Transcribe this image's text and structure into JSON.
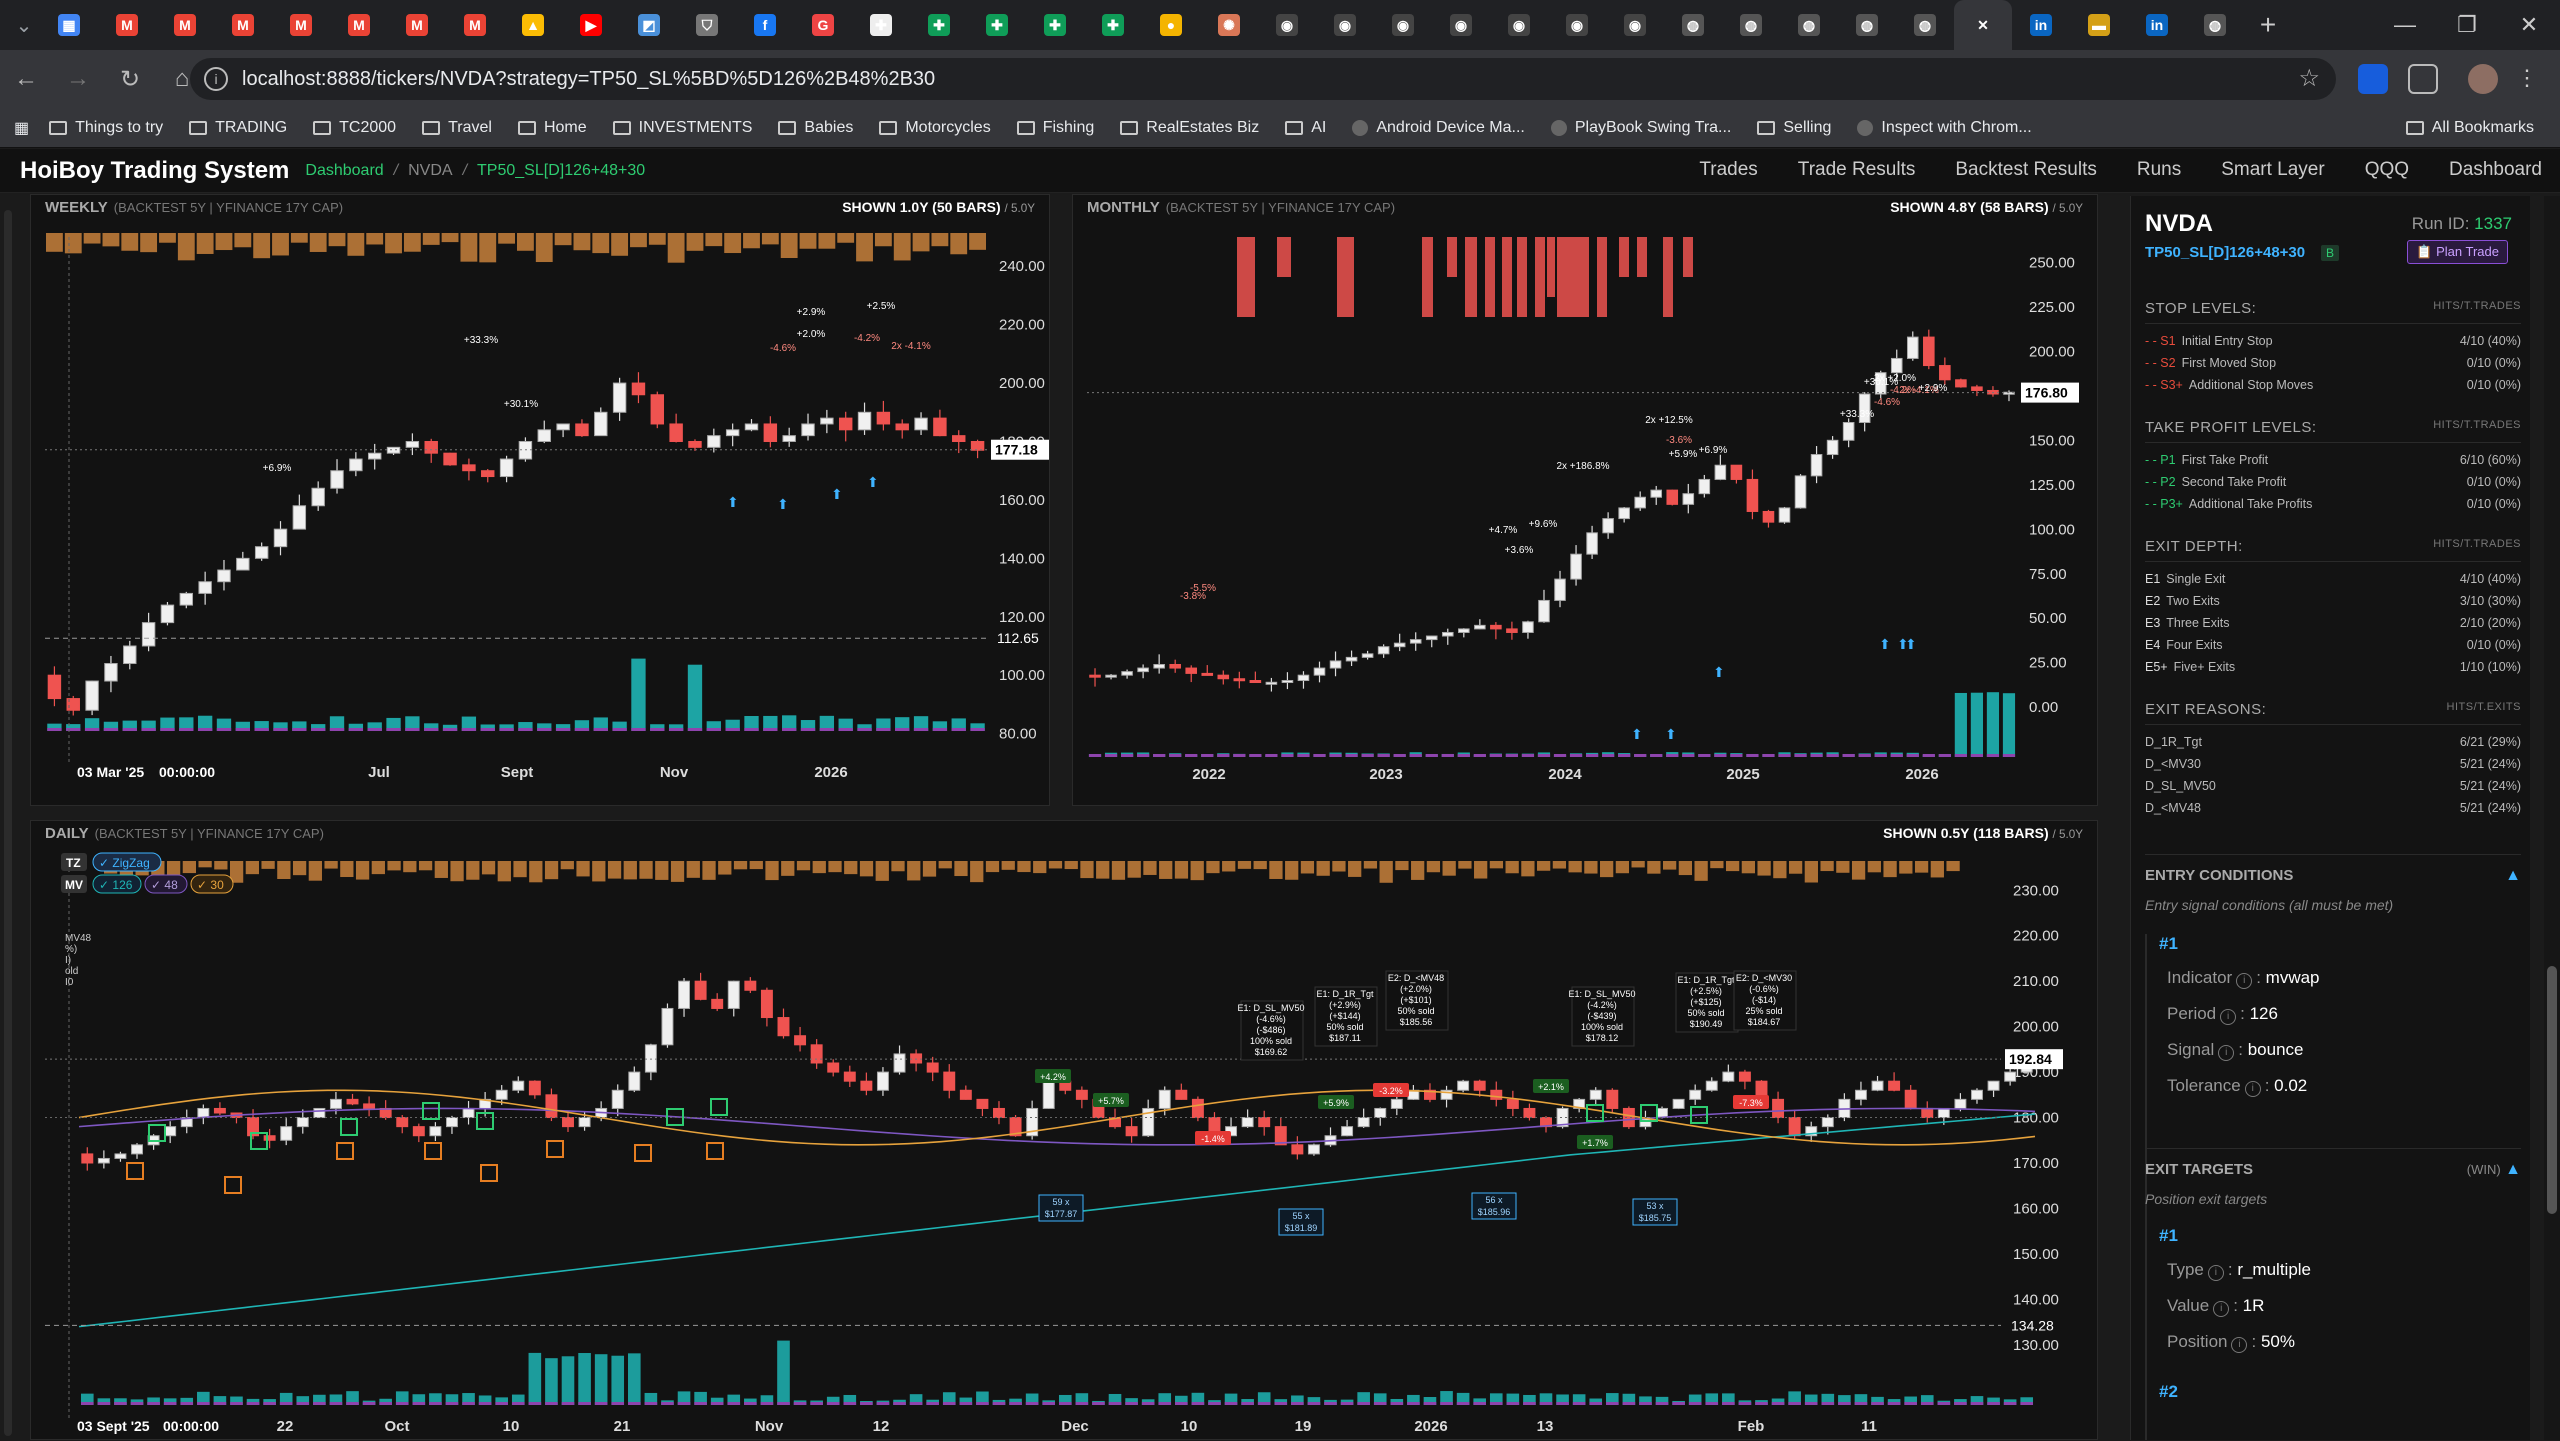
{
  "browser": {
    "url": "localhost:8888/tickers/NVDA?strategy=TP50_SL%5BD%5D126%2B48%2B30",
    "tabs": [
      {
        "icon": "grid-icon",
        "color": "#4285f4",
        "label": "▦"
      },
      {
        "icon": "gmail-icon",
        "color": "#ea4335",
        "label": "M"
      },
      {
        "icon": "gmail-icon",
        "color": "#ea4335",
        "label": "M"
      },
      {
        "icon": "gmail-icon",
        "color": "#ea4335",
        "label": "M"
      },
      {
        "icon": "gmail-icon",
        "color": "#ea4335",
        "label": "M"
      },
      {
        "icon": "gmail-icon",
        "color": "#ea4335",
        "label": "M"
      },
      {
        "icon": "gmail-icon",
        "color": "#ea4335",
        "label": "M"
      },
      {
        "icon": "gmail-icon",
        "color": "#ea4335",
        "label": "M"
      },
      {
        "icon": "drive-icon",
        "color": "#fbbc04",
        "label": "▲"
      },
      {
        "icon": "youtube-icon",
        "color": "#ff0000",
        "label": "▶"
      },
      {
        "icon": "app-icon",
        "color": "#4a90d9",
        "label": "◩"
      },
      {
        "icon": "shield-icon",
        "color": "#777",
        "label": "⛉"
      },
      {
        "icon": "facebook-icon",
        "color": "#1877f2",
        "label": "f"
      },
      {
        "icon": "app-icon",
        "color": "#e44",
        "label": "G"
      },
      {
        "icon": "app-icon",
        "color": "#eee",
        "label": "✚"
      },
      {
        "icon": "sheets-icon",
        "color": "#0f9d58",
        "label": "✚"
      },
      {
        "icon": "sheets-icon",
        "color": "#0f9d58",
        "label": "✚"
      },
      {
        "icon": "sheets-icon",
        "color": "#0f9d58",
        "label": "✚"
      },
      {
        "icon": "sheets-icon",
        "color": "#0f9d58",
        "label": "✚"
      },
      {
        "icon": "coin-icon",
        "color": "#f4b400",
        "label": "●"
      },
      {
        "icon": "claude-icon",
        "color": "#d97757",
        "label": "✺"
      },
      {
        "icon": "github-icon",
        "color": "#444",
        "label": "◉"
      },
      {
        "icon": "github-icon",
        "color": "#444",
        "label": "◉"
      },
      {
        "icon": "github-icon",
        "color": "#444",
        "label": "◉"
      },
      {
        "icon": "github-icon",
        "color": "#444",
        "label": "◉"
      },
      {
        "icon": "github-icon",
        "color": "#444",
        "label": "◉"
      },
      {
        "icon": "github-icon",
        "color": "#444",
        "label": "◉"
      },
      {
        "icon": "github-icon",
        "color": "#444",
        "label": "◉"
      },
      {
        "icon": "globe-icon",
        "color": "#555",
        "label": "◍"
      },
      {
        "icon": "globe-icon",
        "color": "#555",
        "label": "◍"
      },
      {
        "icon": "globe-icon",
        "color": "#555",
        "label": "◍"
      },
      {
        "icon": "globe-icon",
        "color": "#555",
        "label": "◍"
      },
      {
        "icon": "globe-icon",
        "color": "#555",
        "label": "◍"
      },
      {
        "icon": "close-icon",
        "color": "#35363a",
        "label": "✕"
      },
      {
        "icon": "linkedin-icon",
        "color": "#0a66c2",
        "label": "in"
      },
      {
        "icon": "flag-icon",
        "color": "#d4a017",
        "label": "▬"
      },
      {
        "icon": "linkedin-icon",
        "color": "#0a66c2",
        "label": "in"
      },
      {
        "icon": "globe-icon",
        "color": "#555",
        "label": "◍"
      }
    ],
    "bookmarks": [
      {
        "icon": "folder-icon",
        "label": "Things to try"
      },
      {
        "icon": "folder-icon",
        "label": "TRADING"
      },
      {
        "icon": "folder-icon",
        "label": "TC2000"
      },
      {
        "icon": "folder-icon",
        "label": "Travel"
      },
      {
        "icon": "folder-icon",
        "label": "Home"
      },
      {
        "icon": "folder-icon",
        "label": "INVESTMENTS"
      },
      {
        "icon": "folder-icon",
        "label": "Babies"
      },
      {
        "icon": "folder-icon",
        "label": "Motorcycles"
      },
      {
        "icon": "folder-icon",
        "label": "Fishing"
      },
      {
        "icon": "folder-icon",
        "label": "RealEstates Biz"
      },
      {
        "icon": "folder-icon",
        "label": "AI"
      },
      {
        "icon": "android-icon",
        "label": "Android Device Ma..."
      },
      {
        "icon": "playbook-icon",
        "label": "PlayBook Swing Tra..."
      },
      {
        "icon": "folder-icon",
        "label": "Selling"
      },
      {
        "icon": "globe-icon",
        "label": "Inspect with Chrom..."
      }
    ],
    "all_bookmarks": "All Bookmarks"
  },
  "app": {
    "title": "HoiBoy Trading System",
    "breadcrumb": [
      "Dashboard",
      "NVDA",
      "TP50_SL[D]126+48+30"
    ],
    "nav": [
      "Trades",
      "Trade Results",
      "Backtest Results",
      "Runs",
      "Smart Layer",
      "QQQ",
      "Dashboard"
    ]
  },
  "weekly": {
    "title": "WEEKLY",
    "sub": "(BACKTEST 5Y | YFINANCE 17Y CAP)",
    "shown": "SHOWN 1.0Y (50 BARS)",
    "scale": "/ 5.0Y",
    "yticks": [
      "240.00",
      "220.00",
      "200.00",
      "180.00",
      "160.00",
      "140.00",
      "120.00",
      "100.00",
      "80.00"
    ],
    "last_price": "177.18",
    "ref_price": "112.65",
    "xticks": [
      "Jul",
      "Sept",
      "Nov",
      "2026"
    ],
    "cursor_date": "03 Mar '25",
    "cursor_time": "00:00:00",
    "annotations": [
      "+6.9%",
      "+33.3%",
      "+30.1%",
      "+2.9%",
      "+2.0%",
      "-4.6%",
      "+2.5%",
      "-4.2%",
      "2x -4.1%"
    ]
  },
  "monthly": {
    "title": "MONTHLY",
    "sub": "(BACKTEST 5Y | YFINANCE 17Y CAP)",
    "shown": "SHOWN 4.8Y (58 BARS)",
    "scale": "/ 5.0Y",
    "yticks": [
      "250.00",
      "225.00",
      "200.00",
      "175.00",
      "150.00",
      "125.00",
      "100.00",
      "75.00",
      "50.00",
      "25.00",
      "0.00"
    ],
    "last_price": "176.80",
    "xticks": [
      "2022",
      "2023",
      "2024",
      "2025",
      "2026"
    ],
    "annotations": [
      "-5.5%",
      "-3.8%",
      "+4.7%",
      "+9.6%",
      "+3.6%",
      "2x +186.8%",
      "2x +12.5%",
      "-3.6%",
      "+5.9%",
      "+6.9%",
      "+30.1%",
      "+33.3%",
      "2x +2.0%",
      "-4.6%",
      "-4.2%",
      "2x -4.1%",
      "+2.9%"
    ]
  },
  "daily": {
    "title": "DAILY",
    "sub": "(BACKTEST 5Y | YFINANCE 17Y CAP)",
    "shown": "SHOWN 0.5Y (118 BARS)",
    "scale": "/ 5.0Y",
    "yticks": [
      "230.00",
      "220.00",
      "210.00",
      "200.00",
      "190.00",
      "180.00",
      "170.00",
      "160.00",
      "150.00",
      "140.00",
      "130.00"
    ],
    "last_price": "192.84",
    "ref_price": "134.28",
    "xticks": [
      "22",
      "Oct",
      "10",
      "21",
      "Nov",
      "12",
      "Dec",
      "10",
      "19",
      "2026",
      "13",
      "Feb",
      "11"
    ],
    "cursor_date": "03 Sept '25",
    "cursor_time": "00:00:00",
    "legend": {
      "tz": "TZ",
      "zigzag": "✓ ZigZag",
      "mv": "MV",
      "mv126": "✓ 126",
      "mv48": "✓ 48",
      "mv30": "✓ 30"
    },
    "side_labels": [
      "MV48",
      "%)",
      "I)",
      "old",
      "I0"
    ],
    "exits": [
      {
        "lines": [
          "E1: D_SL_MV50",
          "(-4.6%)",
          "(-$486)",
          "100% sold",
          "$169.62"
        ]
      },
      {
        "lines": [
          "E1: D_1R_Tgt",
          "(+2.9%)",
          "(+$144)",
          "50% sold",
          "$187.11"
        ]
      },
      {
        "lines": [
          "E2: D_<MV48",
          "(+2.0%)",
          "(+$101)",
          "50% sold",
          "$185.56"
        ]
      },
      {
        "lines": [
          "E1: D_SL_MV50",
          "(-4.2%)",
          "(-$439)",
          "100% sold",
          "$178.12"
        ]
      },
      {
        "lines": [
          "E1: D_1R_Tgt",
          "(+2.5%)",
          "(+$125)",
          "50% sold",
          "$190.49"
        ]
      },
      {
        "lines": [
          "E2: D_<MV30",
          "(-0.6%)",
          "(-$14)",
          "25% sold",
          "$184.67"
        ]
      }
    ],
    "entries": [
      {
        "lines": [
          "59 x",
          "$177.87"
        ]
      },
      {
        "lines": [
          "55 x",
          "$181.89"
        ]
      },
      {
        "lines": [
          "56 x",
          "$185.96"
        ]
      },
      {
        "lines": [
          "53 x",
          "$185.75"
        ]
      }
    ],
    "pills": [
      "+5.7%",
      "+5.9%",
      "-3.2%",
      "-1.4%",
      "+1.7%",
      "-7.3%",
      "+4.2%",
      "+2.1%"
    ]
  },
  "side": {
    "symbol": "NVDA",
    "run_label": "Run ID:",
    "run_id": "1337",
    "strategy": "TP50_SL[D]126+48+30",
    "badge": "B",
    "plan_button": "📋 Plan Trade",
    "stop_levels": {
      "title": "STOP LEVELS:",
      "hdr": "HITS/T.TRADES",
      "rows": [
        {
          "key": "S1",
          "label": "Initial Entry Stop",
          "val": "4/10 (40%)"
        },
        {
          "key": "S2",
          "label": "First Moved Stop",
          "val": "0/10 (0%)"
        },
        {
          "key": "S3+",
          "label": "Additional Stop Moves",
          "val": "0/10 (0%)"
        }
      ]
    },
    "take_profit": {
      "title": "TAKE PROFIT LEVELS:",
      "hdr": "HITS/T.TRADES",
      "rows": [
        {
          "key": "P1",
          "label": "First Take Profit",
          "val": "6/10 (60%)"
        },
        {
          "key": "P2",
          "label": "Second Take Profit",
          "val": "0/10 (0%)"
        },
        {
          "key": "P3+",
          "label": "Additional Take Profits",
          "val": "0/10 (0%)"
        }
      ]
    },
    "exit_depth": {
      "title": "EXIT DEPTH:",
      "hdr": "HITS/T.TRADES",
      "rows": [
        {
          "key": "E1",
          "label": "Single Exit",
          "val": "4/10 (40%)"
        },
        {
          "key": "E2",
          "label": "Two Exits",
          "val": "3/10 (30%)"
        },
        {
          "key": "E3",
          "label": "Three Exits",
          "val": "2/10 (20%)"
        },
        {
          "key": "E4",
          "label": "Four Exits",
          "val": "0/10 (0%)"
        },
        {
          "key": "E5+",
          "label": "Five+ Exits",
          "val": "1/10 (10%)"
        }
      ]
    },
    "exit_reasons": {
      "title": "EXIT REASONS:",
      "hdr": "HITS/T.EXITS",
      "rows": [
        {
          "label": "D_1R_Tgt",
          "val": "6/21 (29%)"
        },
        {
          "label": "D_<MV30",
          "val": "5/21 (24%)"
        },
        {
          "label": "D_SL_MV50",
          "val": "5/21 (24%)"
        },
        {
          "label": "D_<MV48",
          "val": "5/21 (24%)"
        }
      ]
    },
    "entry_conditions": {
      "title": "ENTRY CONDITIONS",
      "desc": "Entry signal conditions (all must be met)",
      "num": "#1",
      "items": [
        {
          "k": "Indicator",
          "v": "mvwap"
        },
        {
          "k": "Period",
          "v": "126"
        },
        {
          "k": "Signal",
          "v": "bounce"
        },
        {
          "k": "Tolerance",
          "v": "0.02"
        }
      ]
    },
    "exit_targets": {
      "title": "EXIT TARGETS",
      "tag": "(WIN)",
      "desc": "Position exit targets",
      "num": "#1",
      "num2": "#2",
      "items": [
        {
          "k": "Type",
          "v": "r_multiple"
        },
        {
          "k": "Value",
          "v": "1R"
        },
        {
          "k": "Position",
          "v": "50%"
        }
      ]
    }
  },
  "colors": {
    "up": "#e6e6e6",
    "down": "#ef5350",
    "volume": "#1fb5b5",
    "volume_down": "#8e44ad",
    "accent": "#2ecc71",
    "link": "#3fb3ff",
    "mv126": "#1fb5b5",
    "mv48": "#7e57c2",
    "mv30": "#e6a23c"
  }
}
